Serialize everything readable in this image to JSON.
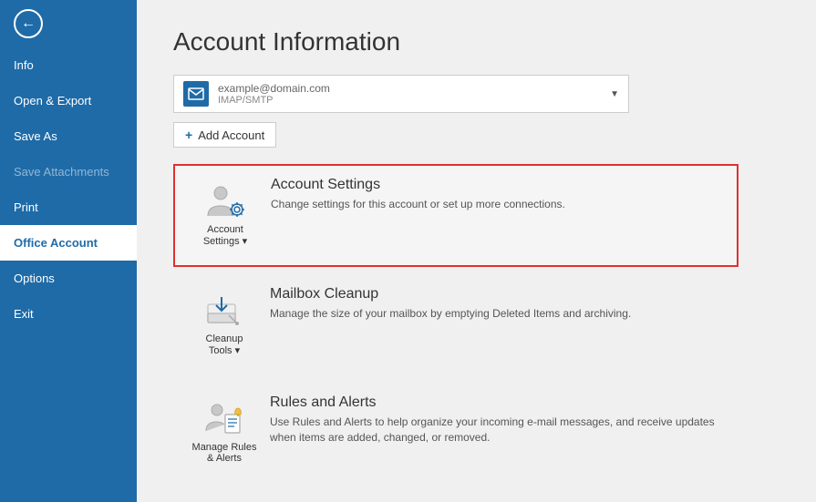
{
  "sidebar": {
    "back_icon": "←",
    "items": [
      {
        "id": "info",
        "label": "Info",
        "active": false,
        "disabled": false
      },
      {
        "id": "open-export",
        "label": "Open & Export",
        "active": false,
        "disabled": false
      },
      {
        "id": "save-as",
        "label": "Save As",
        "active": false,
        "disabled": false
      },
      {
        "id": "save-attachments",
        "label": "Save Attachments",
        "active": false,
        "disabled": true
      },
      {
        "id": "print",
        "label": "Print",
        "active": false,
        "disabled": false
      },
      {
        "id": "office-account",
        "label": "Office Account",
        "active": true,
        "disabled": false
      },
      {
        "id": "options",
        "label": "Options",
        "active": false,
        "disabled": false
      },
      {
        "id": "exit",
        "label": "Exit",
        "active": false,
        "disabled": false
      }
    ]
  },
  "main": {
    "title": "Account Information",
    "account": {
      "email": "example@domain.com",
      "type": "IMAP/SMTP",
      "arrow": "▼"
    },
    "add_account_label": "Add Account",
    "add_account_icon": "+",
    "cards": [
      {
        "id": "account-settings",
        "icon_label": "Account\nSettings ▾",
        "title": "Account Settings",
        "description": "Change settings for this account or set up more connections.",
        "highlighted": true
      },
      {
        "id": "mailbox-cleanup",
        "icon_label": "Cleanup\nTools ▾",
        "title": "Mailbox Cleanup",
        "description": "Manage the size of your mailbox by emptying Deleted Items and archiving.",
        "highlighted": false
      },
      {
        "id": "rules-alerts",
        "icon_label": "Manage Rules\n& Alerts",
        "title": "Rules and Alerts",
        "description": "Use Rules and Alerts to help organize your incoming e-mail messages, and receive updates when items are added, changed, or removed.",
        "highlighted": false
      }
    ]
  },
  "colors": {
    "sidebar_bg": "#1e6ba8",
    "active_item_bg": "#ffffff",
    "highlight_border": "#e03030",
    "accent_blue": "#1e6ba8"
  }
}
